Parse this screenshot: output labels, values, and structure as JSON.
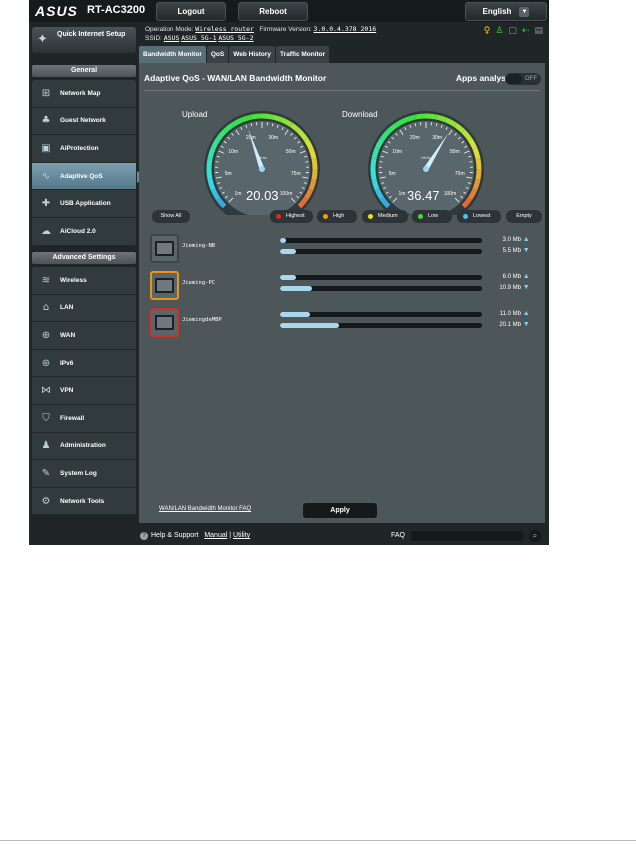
{
  "brand": {
    "logo": "ASUS",
    "model": "RT-AC3200"
  },
  "topbar": {
    "logout": "Logout",
    "reboot": "Reboot",
    "language": "English"
  },
  "info": {
    "mode_label": "Operation Mode:",
    "mode_value": "Wireless router",
    "fw_label": "Firmware Version:",
    "fw_value": "3.0.0.4.378_2016",
    "ssid_label": "SSID:",
    "ssids": [
      "ASUS",
      "ASUS_5G-1",
      "ASUS_5G-2"
    ]
  },
  "sidebar": {
    "quick_setup": "Quick Internet Setup",
    "general_header": "General",
    "general": [
      {
        "label": "Network Map",
        "icon": "network-map-icon"
      },
      {
        "label": "Guest Network",
        "icon": "guest-network-icon"
      },
      {
        "label": "AiProtection",
        "icon": "lock-icon"
      },
      {
        "label": "Adaptive QoS",
        "icon": "qos-icon"
      },
      {
        "label": "USB Application",
        "icon": "puzzle-icon"
      },
      {
        "label": "AiCloud 2.0",
        "icon": "cloud-icon"
      }
    ],
    "advanced_header": "Advanced Settings",
    "advanced": [
      {
        "label": "Wireless",
        "icon": "wifi-icon"
      },
      {
        "label": "LAN",
        "icon": "home-icon"
      },
      {
        "label": "WAN",
        "icon": "globe-icon"
      },
      {
        "label": "IPv6",
        "icon": "ipv6-globe-icon"
      },
      {
        "label": "VPN",
        "icon": "vpn-icon"
      },
      {
        "label": "Firewall",
        "icon": "shield-icon"
      },
      {
        "label": "Administration",
        "icon": "user-icon"
      },
      {
        "label": "System Log",
        "icon": "log-icon"
      },
      {
        "label": "Network Tools",
        "icon": "tools-icon"
      }
    ]
  },
  "tabs": [
    "Bandwidth Monitor",
    "QoS",
    "Web History",
    "Traffic Monitor"
  ],
  "main": {
    "title": "Adaptive QoS - WAN/LAN Bandwidth Monitor",
    "apps_analysis": "Apps analysis",
    "toggle": "OFF",
    "upload": {
      "label": "Upload",
      "value": "20.03"
    },
    "download": {
      "label": "Download",
      "value": "36.47"
    },
    "gauge_ticks": [
      "1m",
      "5m",
      "10m",
      "20m",
      "30m",
      "50m",
      "75m",
      "100m"
    ],
    "gauge_unit": "Mbits",
    "show_all": "Show All",
    "filters": [
      {
        "label": "Highest",
        "color": "#e02a20"
      },
      {
        "label": "High",
        "color": "#f59a12"
      },
      {
        "label": "Medium",
        "color": "#f2e21a"
      },
      {
        "label": "Low",
        "color": "#4ed23a"
      },
      {
        "label": "Lowest",
        "color": "#4fc2f0"
      },
      {
        "label": "Empty",
        "color": ""
      }
    ],
    "devices": [
      {
        "name": "Jieming-NB",
        "up": "3.0",
        "down": "5.5",
        "unit": "Mb",
        "up_frac": 0.03,
        "down_frac": 0.08,
        "border": ""
      },
      {
        "name": "Jieming-PC",
        "up": "6.0",
        "down": "10.9",
        "unit": "Mb",
        "up_frac": 0.08,
        "down_frac": 0.16,
        "border": "#e8941a"
      },
      {
        "name": "JiemingdeMBP",
        "up": "11.0",
        "down": "20.1",
        "unit": "Mb",
        "up_frac": 0.15,
        "down_frac": 0.29,
        "border": "#d23028"
      }
    ],
    "faq_link": "WAN/LAN Bandwidth Monitor FAQ",
    "apply": "Apply"
  },
  "footer": {
    "help": "Help & Support",
    "manual": "Manual",
    "sep": "|",
    "utility": "Utility",
    "faq": "FAQ"
  }
}
